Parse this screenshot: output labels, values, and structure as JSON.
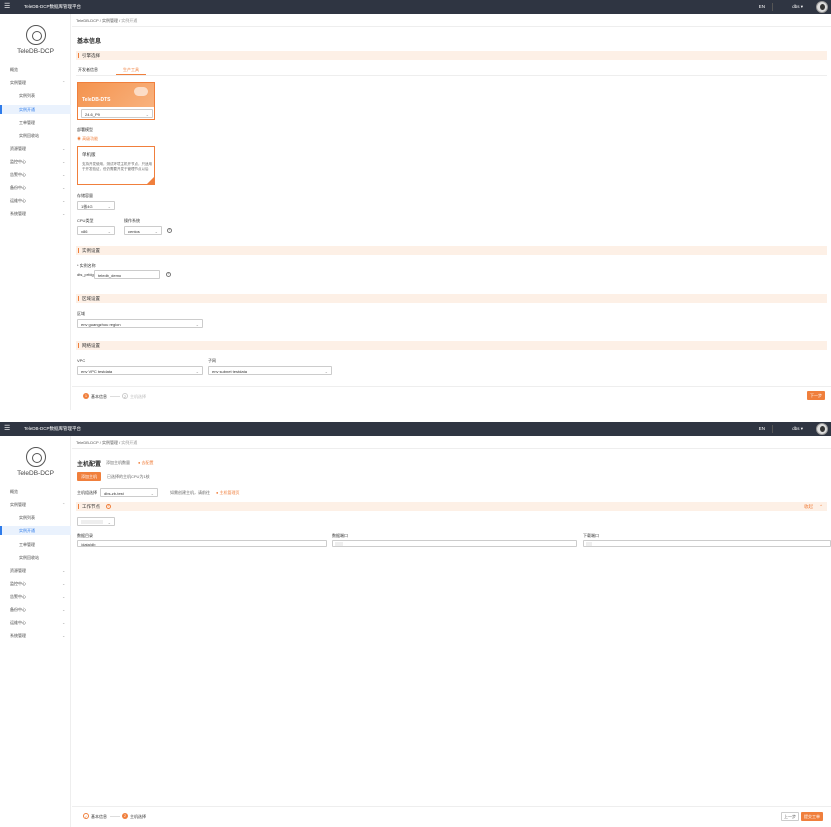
{
  "app_title": "TeleDB-DCP数据库管理平台",
  "brand": "TeleDB-DCP",
  "lang_label": "EN",
  "user_label": "dbs",
  "sidebar": {
    "items1": [
      {
        "label": "概览",
        "sub": false
      },
      {
        "label": "实例管理",
        "sub": false,
        "chev": true
      },
      {
        "label": "实例列表",
        "sub": true
      },
      {
        "label": "实例开通",
        "sub": true,
        "active": true
      },
      {
        "label": "工单管理",
        "sub": true
      },
      {
        "label": "实例回收站",
        "sub": true
      },
      {
        "label": "资源管理",
        "sub": false,
        "chev": true
      },
      {
        "label": "监控中心",
        "sub": false,
        "chev": true
      },
      {
        "label": "告警中心",
        "sub": false,
        "chev": true
      },
      {
        "label": "备份中心",
        "sub": false,
        "chev": true
      },
      {
        "label": "运维中心",
        "sub": false,
        "chev": true
      },
      {
        "label": "系统管理",
        "sub": false,
        "chev": true
      }
    ]
  },
  "breadcrumb": {
    "a": "TeleDB-DCP",
    "b": "实例管理",
    "c": "实例开通"
  },
  "page1": {
    "title": "基本信息",
    "section_product": "引擎选择",
    "tab_a": "开发者信息",
    "tab_b": "生产工具",
    "product_name": "TeleDB-DTS",
    "product_version": "24.6_P9",
    "deploy_label": "部署模型",
    "deploy_option": "高级功能",
    "mode_title": "单机版",
    "mode_desc": "支持开发使用，测试环境主机开节点，只适用于开发验证，但仍需要开发于管理节点以后",
    "arch_label": "存储容量",
    "arch_value": "1核4G",
    "cpu_label": "CPU类型",
    "cpu_value": "x86",
    "os_label": "操作系统",
    "os_value": "centos",
    "section_instance": "实例设置",
    "inst_name_label": "* 实例名称",
    "inst_prefix": "dts_prfdg",
    "inst_value": "teledb_demo",
    "section_region": "区域设置",
    "region_label": "区域",
    "region_value": "env guangzhou region",
    "section_network": "网络设置",
    "vpc_label": "VPC",
    "vpc_value": "env VPC testdata",
    "subnet_label": "子网",
    "subnet_value": "env subnet testdata",
    "step1": "基本信息",
    "step2": "主机选择",
    "next_btn": "下一步"
  },
  "page2": {
    "title": "主机配置",
    "title_note": "添加主机数量",
    "title_link": "去配置",
    "btn_a": "添加主机",
    "note_a": "已选择的主机CPU为1核",
    "host_group_label": "主机组选择",
    "host_group_value": "dbs-zb-test",
    "host_note": "如需创建主机，请前往",
    "host_link": "主机管理页",
    "section_work": "工作节点",
    "section_right": "收起",
    "dir_label": "数据目录",
    "dir_value": "/data/db",
    "port_label": "数据端口",
    "down_label": "下载端口",
    "step1": "基本信息",
    "step2": "主机选择",
    "prev_btn": "上一步",
    "submit_btn": "提交工单"
  },
  "colors": {
    "accent": "#f07f3c",
    "link": "#2e7bea",
    "topbar": "#2f3542"
  }
}
